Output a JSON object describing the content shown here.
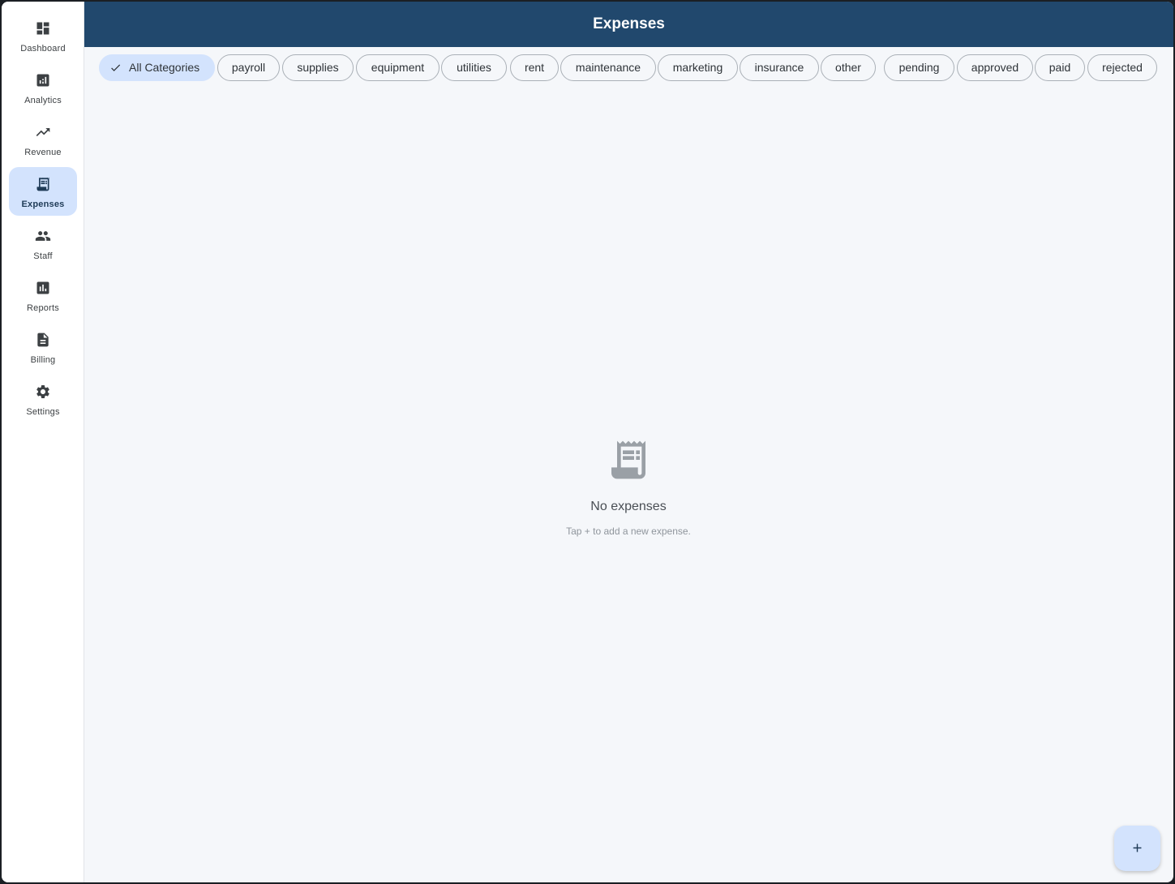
{
  "rail": {
    "items": [
      {
        "label": "Dashboard",
        "icon": "dashboard-icon"
      },
      {
        "label": "Analytics",
        "icon": "analytics-icon"
      },
      {
        "label": "Revenue",
        "icon": "trending-up-icon"
      },
      {
        "label": "Expenses",
        "icon": "receipt-icon",
        "active": true
      },
      {
        "label": "Staff",
        "icon": "people-icon"
      },
      {
        "label": "Reports",
        "icon": "bar-chart-icon"
      },
      {
        "label": "Billing",
        "icon": "document-icon"
      },
      {
        "label": "Settings",
        "icon": "gear-icon"
      }
    ]
  },
  "appbar": {
    "title": "Expenses"
  },
  "filters": {
    "categories": [
      "All Categories",
      "payroll",
      "supplies",
      "equipment",
      "utilities",
      "rent",
      "maintenance",
      "marketing",
      "insurance",
      "other"
    ],
    "statuses": [
      "pending",
      "approved",
      "paid",
      "rejected"
    ],
    "selected": "All Categories"
  },
  "empty_state": {
    "icon": "receipt-icon",
    "title": "No expenses",
    "subtitle": "Tap + to add a new expense."
  },
  "fab": {
    "icon": "plus-icon"
  },
  "colors": {
    "appbar": "#21486d",
    "accent": "#d3e3fd",
    "background": "#f5f7fa"
  }
}
